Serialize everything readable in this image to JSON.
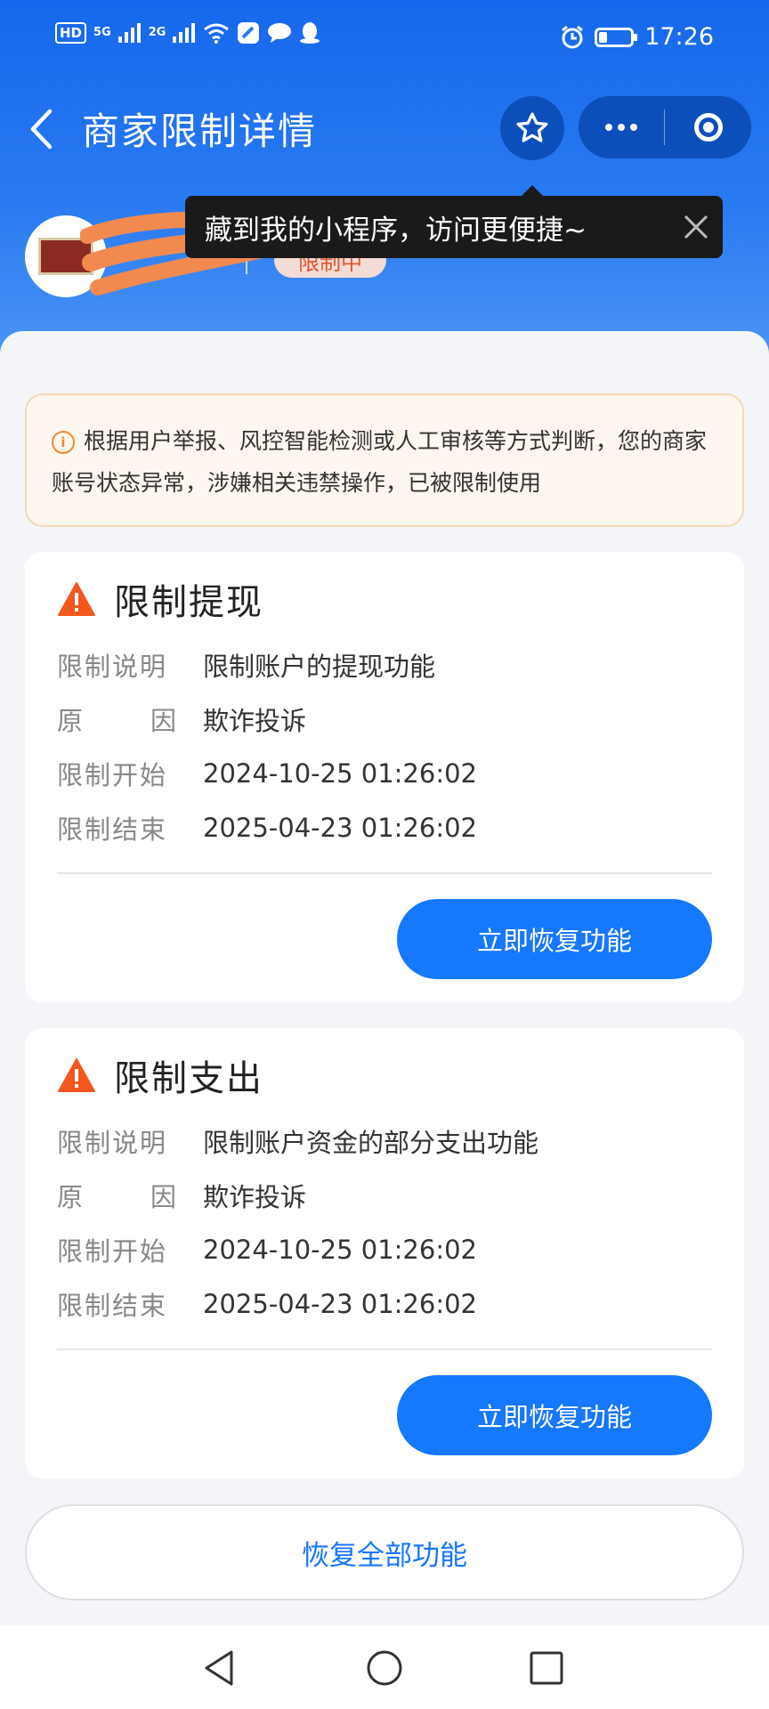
{
  "status_bar": {
    "network_badge": "HD",
    "signal_1": "5G",
    "signal_2": "2G",
    "time": "17:26",
    "battery_level": 0.25,
    "icons": [
      "hd-icon",
      "signal-5g-icon",
      "signal-2g-icon",
      "wifi-icon",
      "app-icon",
      "chat-icon",
      "qq-icon",
      "alarm-icon",
      "battery-icon"
    ]
  },
  "nav": {
    "title": "商家限制详情",
    "back_icon": "chevron-left-icon",
    "favorite_icon": "star-icon",
    "more_icon": "more-dots-icon",
    "close_icon": "target-icon"
  },
  "tooltip": {
    "text": "藏到我的小程序，访问更便捷~"
  },
  "merchant": {
    "status": "限制中"
  },
  "notice": {
    "text": "根据用户举报、风控智能检测或人工审核等方式判断，您的商家账号状态异常，涉嫌相关违禁操作，已被限制使用"
  },
  "labels": {
    "desc": "限制说明",
    "reason_1": "原",
    "reason_2": "因",
    "start": "限制开始",
    "end": "限制结束"
  },
  "restrictions": [
    {
      "title": "限制提现",
      "description": "限制账户的提现功能",
      "reason": "欺诈投诉",
      "start": "2024-10-25 01:26:02",
      "end": "2025-04-23 01:26:02",
      "button": "立即恢复功能"
    },
    {
      "title": "限制支出",
      "description": "限制账户资金的部分支出功能",
      "reason": "欺诈投诉",
      "start": "2024-10-25 01:26:02",
      "end": "2025-04-23 01:26:02",
      "button": "立即恢复功能"
    }
  ],
  "restore_all": "恢复全部功能",
  "colors": {
    "header_blue": "#1668ec",
    "primary": "#1677ff",
    "warning": "#f2571e",
    "notice_bg": "#fdf7ef",
    "badge_text": "#e0552f"
  }
}
